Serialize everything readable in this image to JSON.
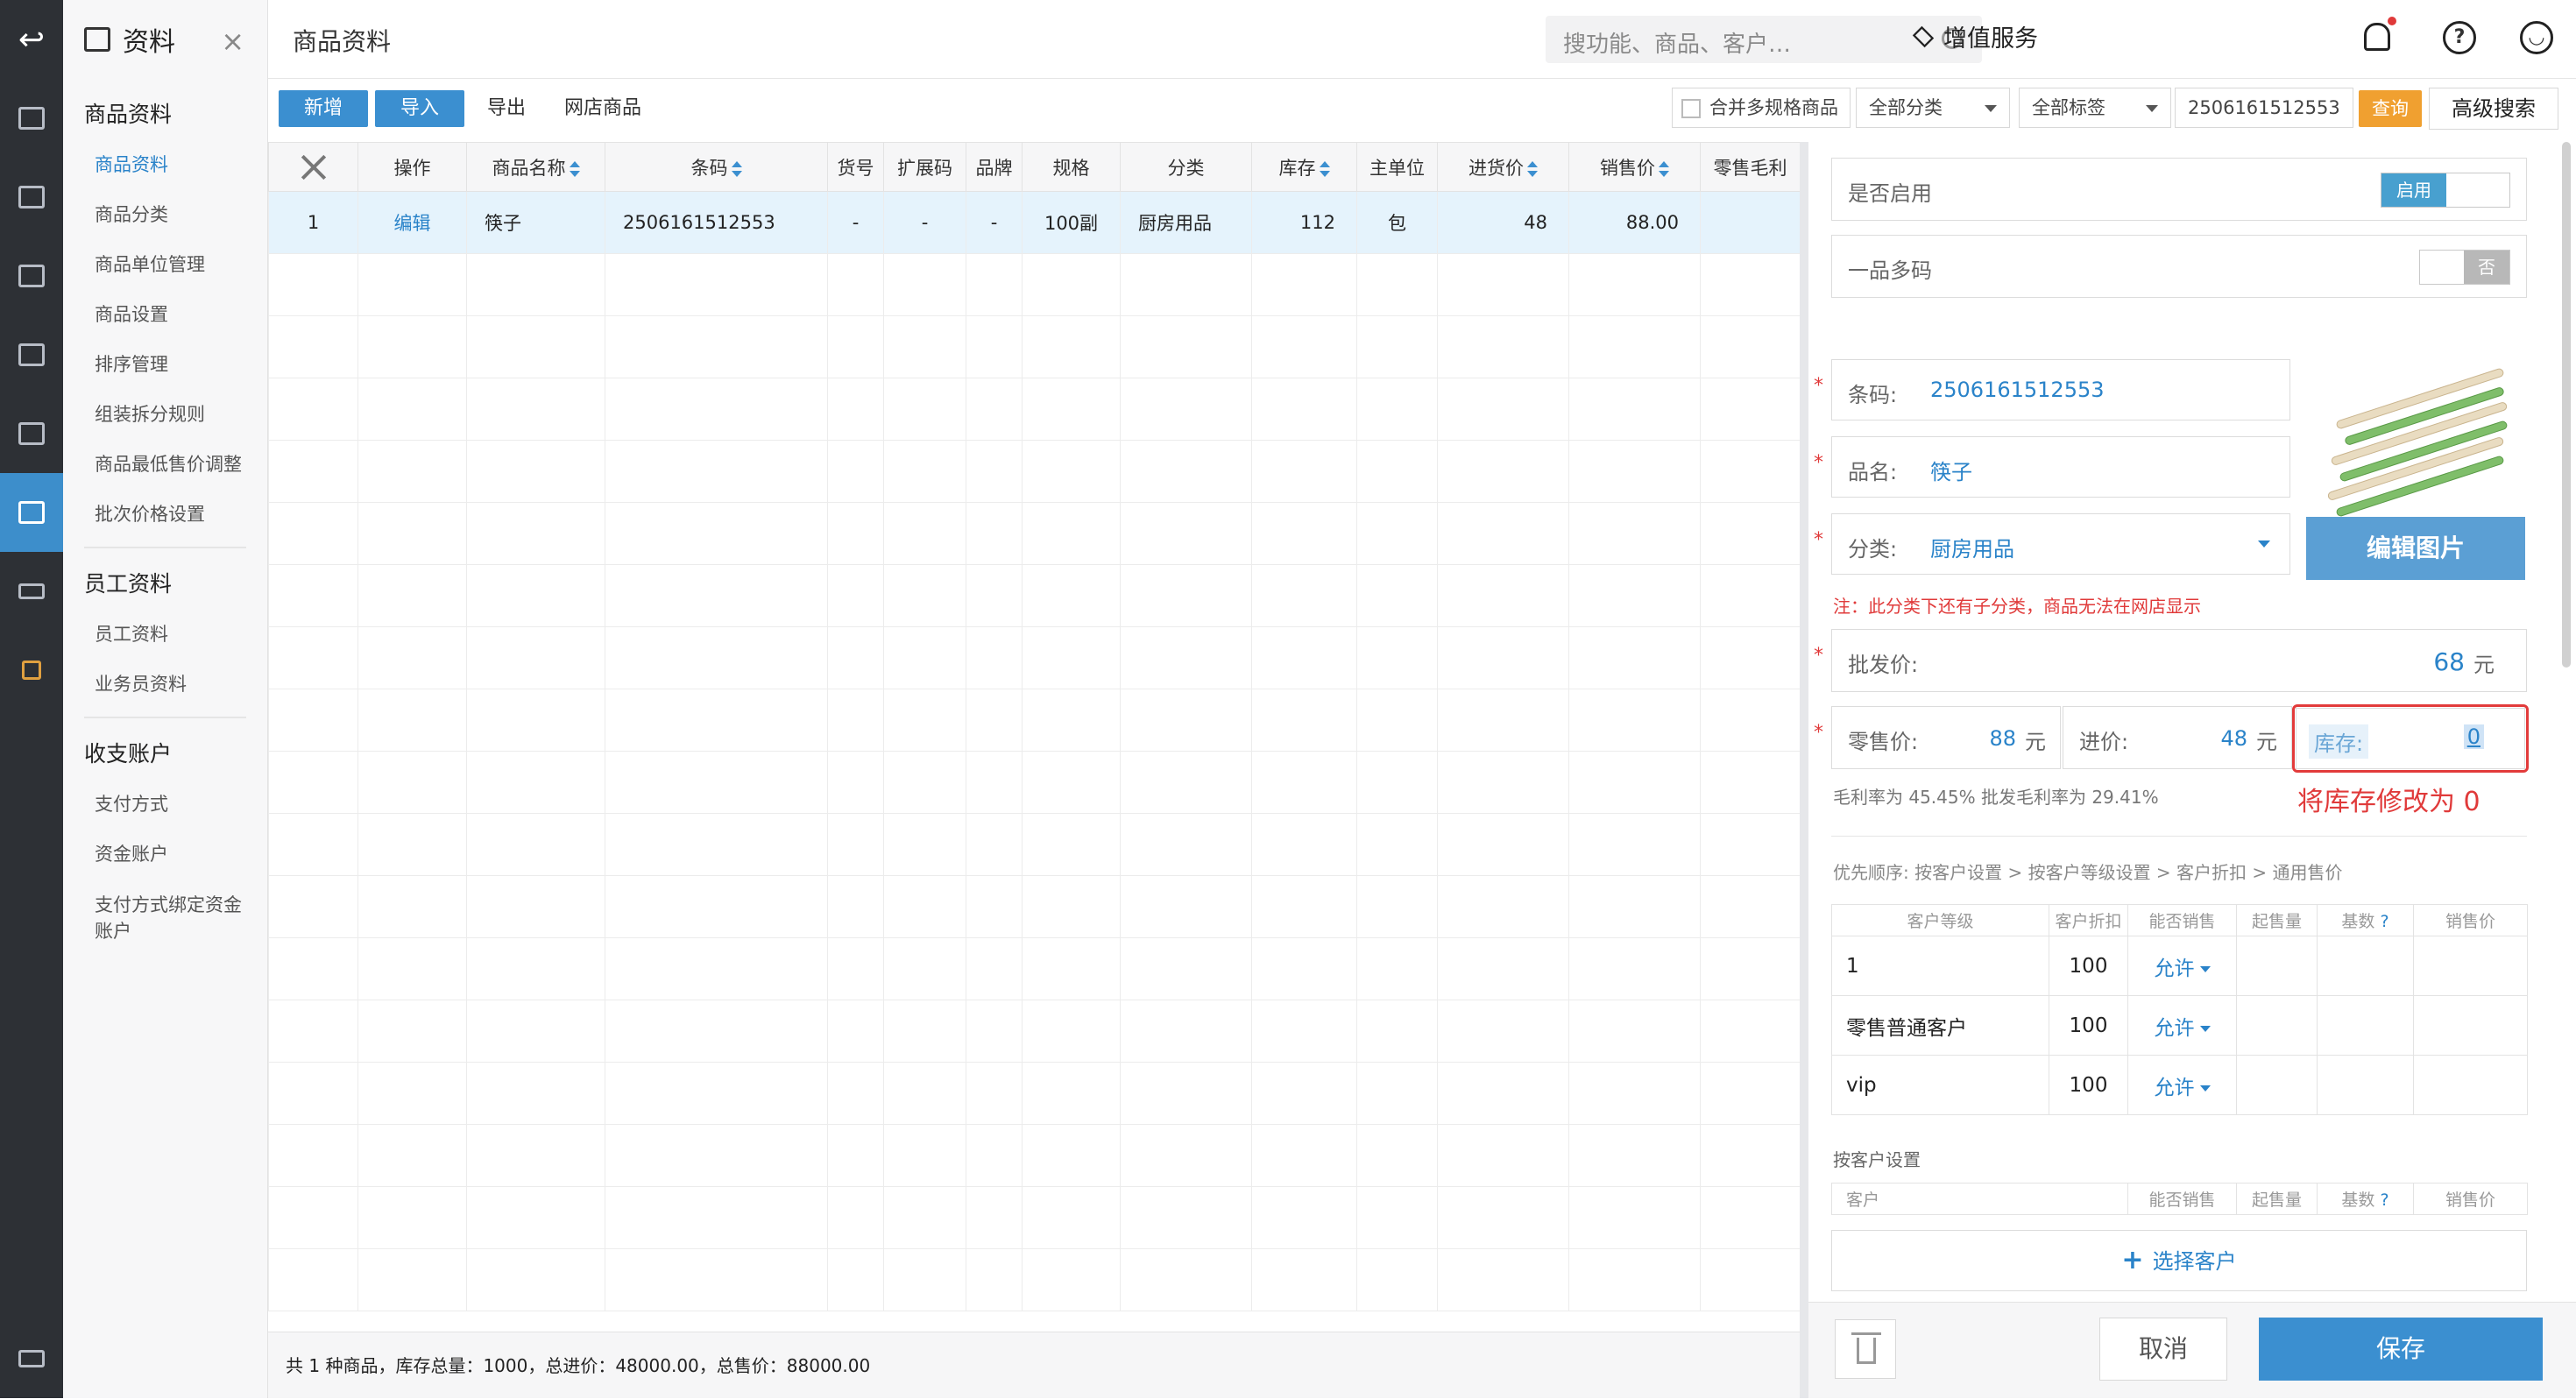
{
  "nav": {
    "header": "资料",
    "sections": [
      {
        "title": "商品资料",
        "items": [
          "商品资料",
          "商品分类",
          "商品单位管理",
          "商品设置",
          "排序管理",
          "组装拆分规则",
          "商品最低售价调整",
          "批次价格设置"
        ]
      },
      {
        "title": "员工资料",
        "items": [
          "员工资料",
          "业务员资料"
        ]
      },
      {
        "title": "收支账户",
        "items": [
          "支付方式",
          "资金账户",
          "支付方式绑定资金账户"
        ]
      }
    ]
  },
  "header": {
    "title": "商品资料",
    "search_placeholder": "搜功能、商品、客户…",
    "value_service": "增值服务"
  },
  "toolbar": {
    "new_label": "新增",
    "import_label": "导入",
    "export_label": "导出",
    "online_label": "网店商品",
    "merge_label": "合并多规格商品",
    "category_select": "全部分类",
    "tag_select": "全部标签",
    "barcode_value": "2506161512553",
    "query_label": "查询",
    "advanced_label": "高级搜索"
  },
  "table": {
    "columns": [
      "",
      "操作",
      "商品名称",
      "条码",
      "货号",
      "扩展码",
      "品牌",
      "规格",
      "分类",
      "库存",
      "主单位",
      "进货价",
      "销售价",
      "零售毛利"
    ],
    "rows": [
      [
        "1",
        "编辑",
        "筷子",
        "2506161512553",
        "-",
        "-",
        "-",
        "100副",
        "厨房用品",
        "112",
        "包",
        "48",
        "88.00",
        ""
      ]
    ],
    "footer": "共 1 种商品，库存总量：1000，总进价：48000.00，总售价：88000.00"
  },
  "panel": {
    "enable_label": "是否启用",
    "enable_toggle": "启用",
    "multicode_label": "一品多码",
    "multicode_toggle": "否",
    "barcode_label": "条码:",
    "barcode_value": "2506161512553",
    "name_label": "品名:",
    "name_value": "筷子",
    "category_label": "分类:",
    "category_value": "厨房用品",
    "edit_image": "编辑图片",
    "category_note": "注：此分类下还有子分类，商品无法在网店显示",
    "wholesale_label": "批发价:",
    "wholesale_value": "68",
    "unit": "元",
    "retail_label": "零售价:",
    "retail_value": "88",
    "cost_label": "进价:",
    "cost_value": "48",
    "stock_label": "库存:",
    "stock_value": "0",
    "annotation": "将库存修改为 0",
    "margin_text": "毛利率为 45.45% 批发毛利率为 29.41%",
    "priority_text": "优先顺序:  按客户设置 > 按客户等级设置 > 客户折扣 > 通用售价",
    "level_columns": [
      "客户等级",
      "客户折扣",
      "能否销售",
      "起售量",
      "基数",
      "销售价"
    ],
    "level_rows": [
      [
        "1",
        "100",
        "允许"
      ],
      [
        "零售普通客户",
        "100",
        "允许"
      ],
      [
        "vip",
        "100",
        "允许"
      ]
    ],
    "by_customer_label": "按客户设置",
    "customer_columns": [
      "客户",
      "能否销售",
      "起售量",
      "基数",
      "销售价"
    ],
    "choose_customer": "选择客户",
    "cancel_label": "取消",
    "save_label": "保存"
  },
  "colors": {
    "accent": "#3b8fd0",
    "rail": "#2d3035",
    "warn": "#e03a3a",
    "orange": "#f0a030"
  }
}
